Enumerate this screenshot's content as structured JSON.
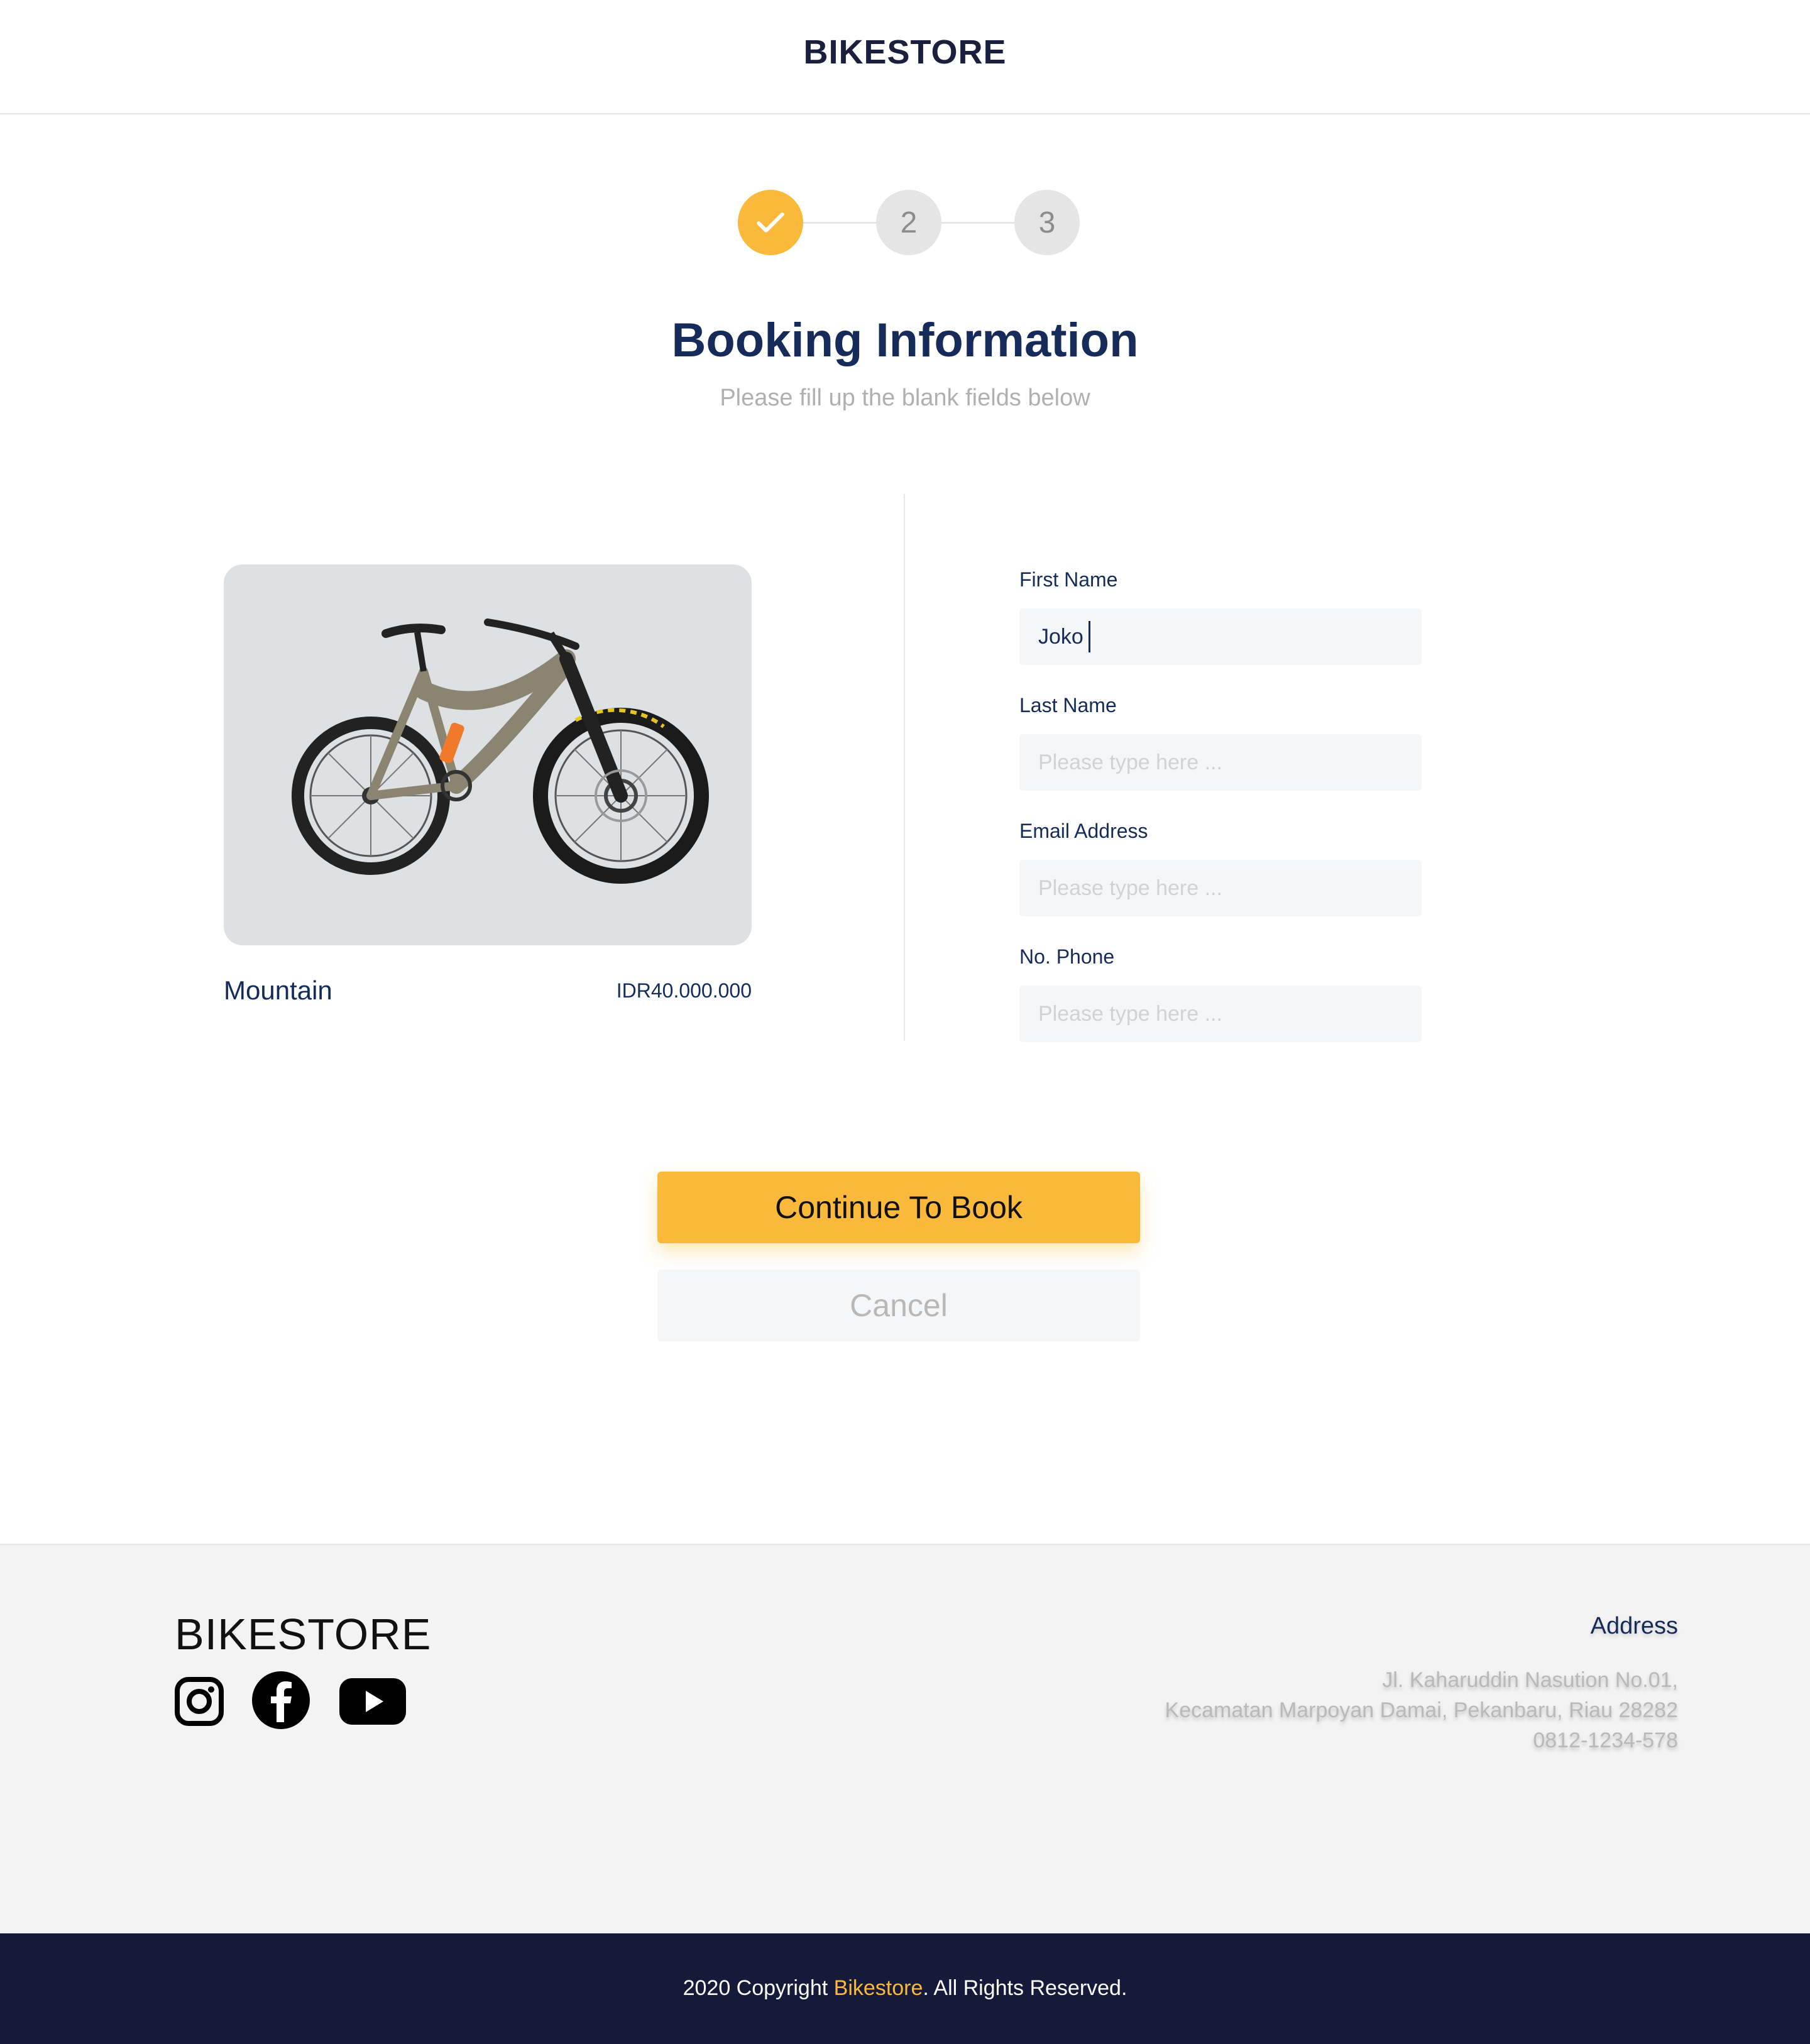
{
  "header": {
    "brand": "BIKESTORE"
  },
  "stepper": {
    "steps": [
      {
        "label": "",
        "state": "done"
      },
      {
        "label": "2",
        "state": "pending"
      },
      {
        "label": "3",
        "state": "pending"
      }
    ],
    "accent_color": "#FBB93B"
  },
  "page": {
    "title": "Booking Information",
    "subtitle": "Please fill up the blank fields below"
  },
  "product": {
    "name": "Mountain",
    "price": "IDR40.000.000"
  },
  "form": {
    "first_name": {
      "label": "First Name",
      "value": "Joko"
    },
    "last_name": {
      "label": "Last Name",
      "placeholder": "Please type here ..."
    },
    "email": {
      "label": "Email Address",
      "placeholder": "Please type here ..."
    },
    "phone": {
      "label": "No. Phone",
      "placeholder": "Please type here ..."
    }
  },
  "actions": {
    "continue_label": "Continue To Book",
    "cancel_label": "Cancel"
  },
  "footer": {
    "brand": "BIKESTORE",
    "social": [
      "instagram-icon",
      "facebook-icon",
      "youtube-icon"
    ],
    "address_title": "Address",
    "address_lines": [
      "Jl. Kaharuddin Nasution No.01,",
      "Kecamatan Marpoyan Damai, Pekanbaru, Riau 28282",
      "0812-1234-578"
    ]
  },
  "copyright": {
    "prefix": "2020 Copyright ",
    "highlight": "Bikestore",
    "suffix": ". All Rights Reserved."
  }
}
